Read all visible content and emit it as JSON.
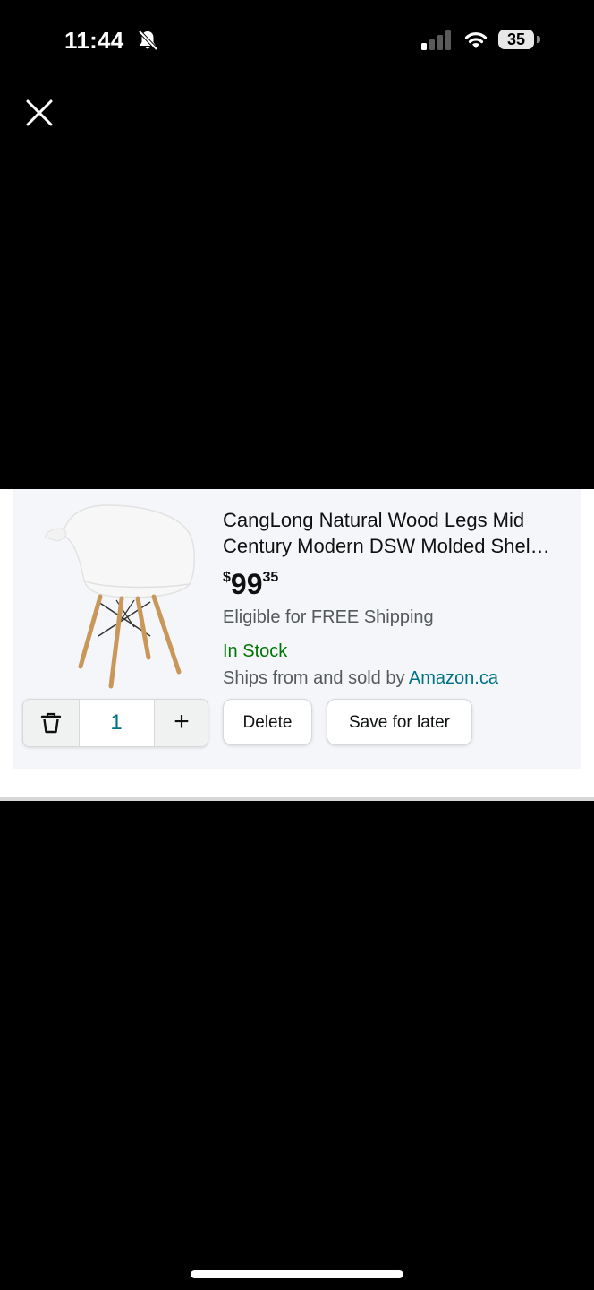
{
  "status_bar": {
    "time": "11:44",
    "battery": "35",
    "icons": [
      "bell-slash-icon",
      "signal-icon",
      "wifi-icon",
      "battery-icon"
    ]
  },
  "viewer": {
    "close_icon": "close-icon"
  },
  "product": {
    "title_line1": "CangLong Natural Wood Legs Mid",
    "title_line2": "Century Modern DSW Molded Shel…",
    "price_symbol": "$",
    "price_whole": "99",
    "price_fraction": "35",
    "shipping": "Eligible for FREE Shipping",
    "stock": "In Stock",
    "seller_prefix": "Ships from and sold by ",
    "seller_name": "Amazon.ca",
    "image": "white-molded-shell-armchair-with-wood-legs"
  },
  "actions": {
    "quantity": "1",
    "plus_label": "+",
    "delete_label": "Delete",
    "save_label": "Save for later"
  },
  "colors": {
    "link": "#007185",
    "in_stock": "#007600",
    "card_bg": "#f4f6f9"
  }
}
